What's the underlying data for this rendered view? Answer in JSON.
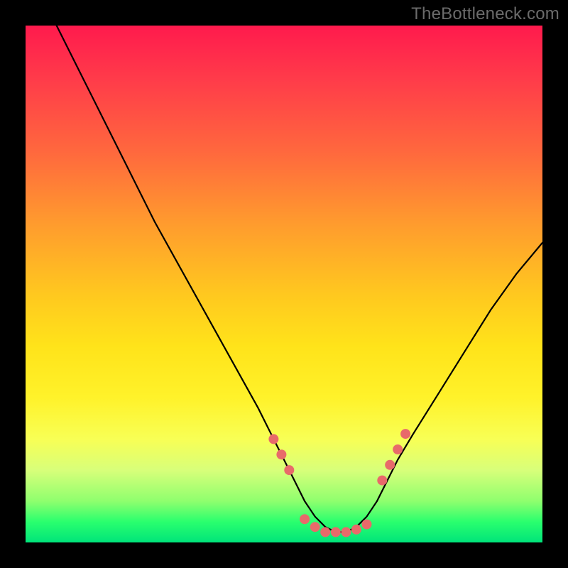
{
  "watermark": "TheBottleneck.com",
  "chart_data": {
    "type": "line",
    "title": "",
    "xlabel": "",
    "ylabel": "",
    "xlim": [
      0,
      100
    ],
    "ylim": [
      0,
      100
    ],
    "grid": false,
    "legend": false,
    "series": [
      {
        "name": "bottleneck-curve",
        "color": "#000000",
        "x": [
          6,
          10,
          15,
          20,
          25,
          30,
          35,
          40,
          45,
          48,
          50,
          52,
          54,
          56,
          58,
          60,
          62,
          64,
          66,
          68,
          70,
          72,
          75,
          80,
          85,
          90,
          95,
          100
        ],
        "y": [
          100,
          92,
          82,
          72,
          62,
          53,
          44,
          35,
          26,
          20,
          16,
          12,
          8,
          5,
          3,
          2,
          2,
          3,
          5,
          8,
          12,
          16,
          21,
          29,
          37,
          45,
          52,
          58
        ]
      }
    ],
    "markers": {
      "name": "highlight-dots",
      "color": "#e86a6a",
      "radius_px": 7,
      "x": [
        48,
        49.5,
        51,
        54,
        56,
        58,
        60,
        62,
        64,
        66,
        69,
        70.5,
        72,
        73.5
      ],
      "y": [
        20,
        17,
        14,
        4.5,
        3,
        2,
        2,
        2,
        2.5,
        3.5,
        12,
        15,
        18,
        21
      ]
    },
    "gradient_stops": [
      {
        "pos": 0.0,
        "color": "#ff1a4d"
      },
      {
        "pos": 0.1,
        "color": "#ff3a4a"
      },
      {
        "pos": 0.25,
        "color": "#ff6a3d"
      },
      {
        "pos": 0.38,
        "color": "#ff9a2e"
      },
      {
        "pos": 0.52,
        "color": "#ffc81f"
      },
      {
        "pos": 0.62,
        "color": "#ffe31a"
      },
      {
        "pos": 0.72,
        "color": "#fff22a"
      },
      {
        "pos": 0.8,
        "color": "#f8ff55"
      },
      {
        "pos": 0.86,
        "color": "#d8ff7a"
      },
      {
        "pos": 0.92,
        "color": "#8fff6e"
      },
      {
        "pos": 0.96,
        "color": "#2aff6e"
      },
      {
        "pos": 1.0,
        "color": "#00e47a"
      }
    ]
  }
}
